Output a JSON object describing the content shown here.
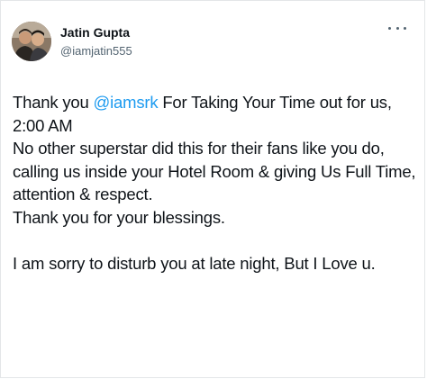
{
  "tweet": {
    "author_name": "Jatin Gupta",
    "author_handle": "@iamjatin555",
    "text": {
      "line1_before": "Thank you ",
      "mention": "@iamsrk",
      "line1_after": " For Taking Your Time out for us,",
      "line2": "2:00 AM",
      "line3": "No other superstar did this for their fans like you do,",
      "line4": "calling us inside your Hotel Room & giving Us Full Time,",
      "line5": "attention & respect.",
      "line6": "Thank you for your blessings.",
      "line7": "I am sorry to disturb you at late night, But I Love u."
    }
  },
  "colors": {
    "mention": "#1d9bf0",
    "text": "#0f1419",
    "secondary": "#536471"
  },
  "icons": {
    "more": "more-horizontal-icon"
  }
}
